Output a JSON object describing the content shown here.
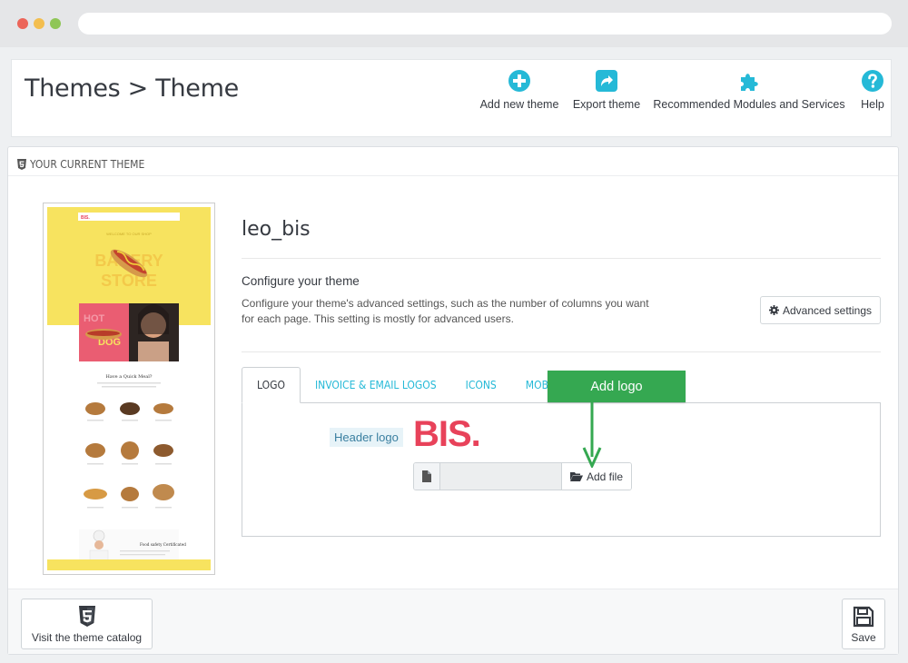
{
  "header": {
    "title": "Themes > Theme",
    "toolbar": {
      "add_label": "Add new theme",
      "export_label": "Export theme",
      "modules_label": "Recommended Modules and Services",
      "help_label": "Help"
    }
  },
  "panel": {
    "heading": "YOUR CURRENT THEME",
    "theme_name": "leo_bis",
    "configure_title": "Configure your theme",
    "configure_desc": "Configure your theme's advanced settings, such as the number of columns you want for each page. This setting is mostly for advanced users.",
    "advanced_label": "Advanced settings",
    "tabs": [
      "LOGO",
      "INVOICE & EMAIL LOGOS",
      "ICONS",
      "MOBILE"
    ],
    "header_logo_label": "Header logo",
    "logo_text": "BIS.",
    "add_file_label": "Add file",
    "callout": "Add logo",
    "catalog_label": "Visit the theme catalog",
    "save_label": "Save"
  },
  "preview": {
    "logo": "BIS.",
    "hero_small": "WELCOME TO OUR SHOP",
    "hero_line1": "BAKERY",
    "hero_line2": "STORE",
    "promo_line1": "HOT",
    "promo_line2": "DOG",
    "section_title": "Have a Quick Meal?",
    "footer_title": "Food safety Certificated"
  },
  "colors": {
    "accent": "#25b9d7",
    "callout": "#35a851",
    "logo": "#e8425a",
    "preview_yellow": "#f7e35f"
  }
}
